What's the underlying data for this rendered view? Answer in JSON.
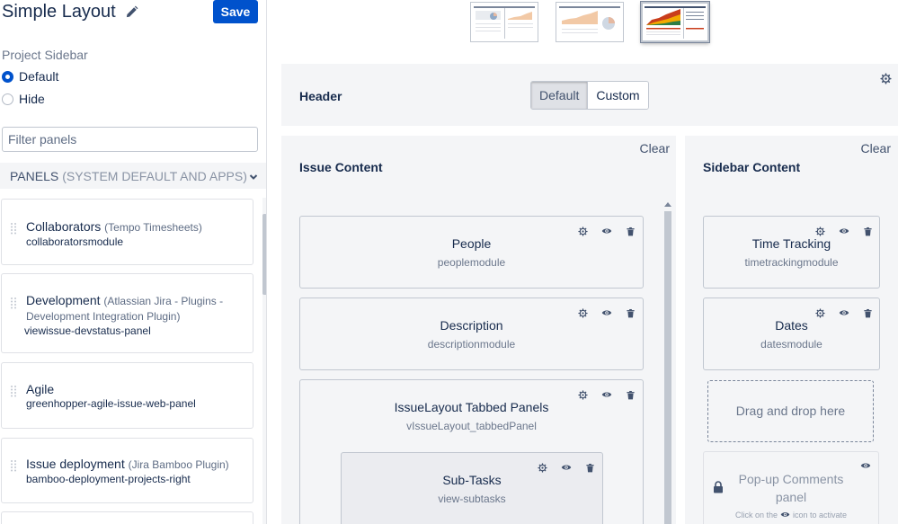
{
  "page": {
    "title": "Simple Layout",
    "save_label": "Save"
  },
  "project_sidebar": {
    "label": "Project Sidebar",
    "options": [
      {
        "label": "Default",
        "checked": true
      },
      {
        "label": "Hide",
        "checked": false
      }
    ]
  },
  "filter": {
    "placeholder": "Filter panels",
    "value": ""
  },
  "panels_header": {
    "main": "PANELS",
    "sub": "(SYSTEM DEFAULT AND APPS)"
  },
  "panels": [
    {
      "name": "Collaborators",
      "source": "(Tempo Timesheets)",
      "key": "collaboratorsmodule"
    },
    {
      "name": "Development",
      "source": "(Atlassian Jira - Plugins - Development Integration Plugin)",
      "key": "viewissue-devstatus-panel"
    },
    {
      "name": "Agile",
      "source": "",
      "key": "greenhopper-agile-issue-web-panel"
    },
    {
      "name": "Issue deployment",
      "source": "(Jira Bamboo Plugin)",
      "key": "bamboo-deployment-projects-right"
    }
  ],
  "header_section": {
    "title": "Header",
    "options": [
      "Default",
      "Custom"
    ],
    "selected": "Default"
  },
  "issue_content": {
    "title": "Issue Content",
    "clear_label": "Clear",
    "cards": [
      {
        "title": "People",
        "key": "peoplemodule"
      },
      {
        "title": "Description",
        "key": "descriptionmodule"
      },
      {
        "title": "IssueLayout Tabbed Panels",
        "key": "vIssueLayout_tabbedPanel"
      },
      {
        "title": "Sub-Tasks",
        "key": "view-subtasks"
      }
    ]
  },
  "sidebar_content": {
    "title": "Sidebar Content",
    "clear_label": "Clear",
    "cards": [
      {
        "title": "Time Tracking",
        "key": "timetrackingmodule"
      },
      {
        "title": "Dates",
        "key": "datesmodule"
      }
    ],
    "dropzone_label": "Drag and drop here",
    "popup": {
      "title": "Pop-up Comments panel",
      "hint_before": "Click on the",
      "hint_after": "icon to activate"
    }
  },
  "colors": {
    "primary": "#0052cc",
    "panel_bg": "#f4f5f7",
    "text": "#172b4d"
  },
  "icons": [
    "pencil-icon",
    "chevron-down-icon",
    "drag-handle-icon",
    "gear-icon",
    "eye-icon",
    "trash-icon",
    "lock-icon",
    "eye-off-icon"
  ]
}
